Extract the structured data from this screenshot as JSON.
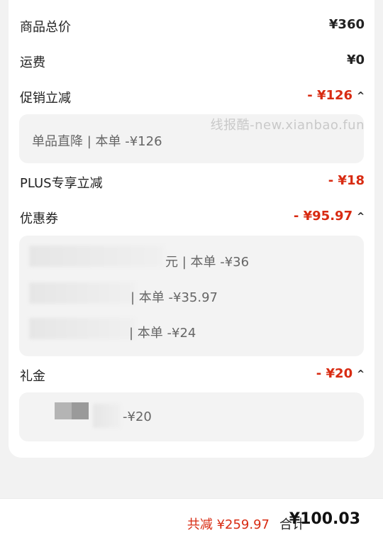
{
  "summary": {
    "goods_total": {
      "label": "商品总价",
      "value": "¥360"
    },
    "shipping": {
      "label": "运费",
      "value": "¥0"
    },
    "promotion": {
      "label": "促销立减",
      "value": "- ¥126",
      "detail": "单品直降 | 本单 -¥126"
    },
    "plus": {
      "label": "PLUS专享立减",
      "value": "- ¥18"
    },
    "coupons": {
      "label": "优惠券",
      "value": "- ¥95.97",
      "items": [
        "元 | 本单 -¥36",
        "| 本单 -¥35.97",
        "| 本单 -¥24"
      ]
    },
    "gift": {
      "label": "礼金",
      "value": "- ¥20",
      "detail": "-¥20"
    }
  },
  "watermark": "线报酷-new.xianbao.fun",
  "footer": {
    "saved": "共减 ¥259.97",
    "total_label": "合计",
    "total": "¥100.03"
  },
  "icons": {
    "expand": "chevron-up-icon"
  },
  "colors": {
    "accent_red": "#d82b12",
    "panel_bg": "#f3f3f3"
  }
}
